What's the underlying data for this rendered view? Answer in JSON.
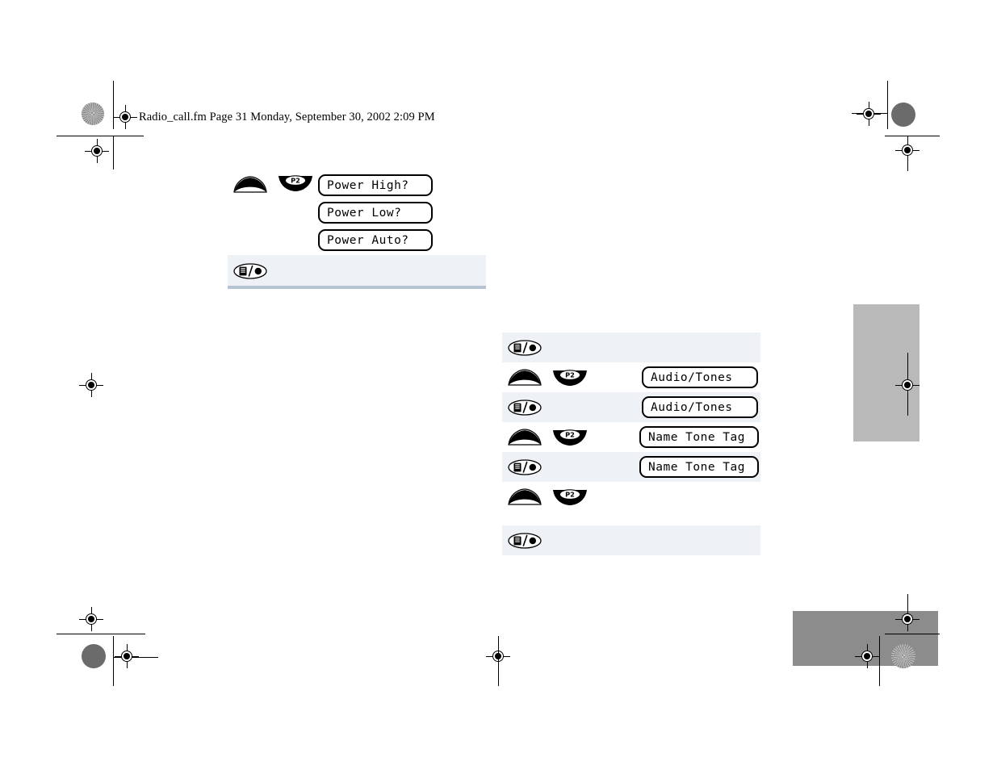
{
  "header": {
    "slug": "Radio_call.fm  Page 31  Monday, September 30, 2002  2:09 PM"
  },
  "icons": {
    "dome": "dome-key-icon",
    "p2": "p2-key-icon",
    "p2_label": "P2",
    "menu": "menu-select-key-icon"
  },
  "procedure_top": {
    "name": "power-level-procedure",
    "rows": [
      {
        "key1": "dome",
        "key2": "p2",
        "displays": [
          "Power High?",
          "Power Low?",
          "Power Auto?"
        ],
        "shaded": false
      },
      {
        "key1": "menu",
        "key2": "",
        "displays": [],
        "shaded": true
      }
    ]
  },
  "procedure_bottom": {
    "name": "name-tone-tag-procedure",
    "rows": [
      {
        "key1": "menu",
        "key2": "",
        "display": "",
        "shaded": true
      },
      {
        "key1": "dome",
        "key2": "p2",
        "display": "Audio/Tones",
        "shaded": false
      },
      {
        "key1": "menu",
        "key2": "",
        "display": "Audio/Tones",
        "shaded": true
      },
      {
        "key1": "dome",
        "key2": "p2",
        "display": "Name Tone Tag",
        "shaded": false
      },
      {
        "key1": "menu",
        "key2": "",
        "display": "Name Tone Tag",
        "shaded": true
      },
      {
        "key1": "dome",
        "key2": "p2",
        "display": "",
        "shaded": false
      },
      {
        "key1": "",
        "key2": "",
        "display": "",
        "shaded": false
      },
      {
        "key1": "menu",
        "key2": "",
        "display": "",
        "shaded": true
      }
    ]
  },
  "colors": {
    "row_shade": "#eef2f6",
    "table_rule": "#b6c4d2",
    "tab_gray": "#b9b9b9",
    "footer_gray": "#8c8c8c",
    "ink": "#000000"
  },
  "print_marks": {
    "label": "registration-and-crop-marks"
  }
}
